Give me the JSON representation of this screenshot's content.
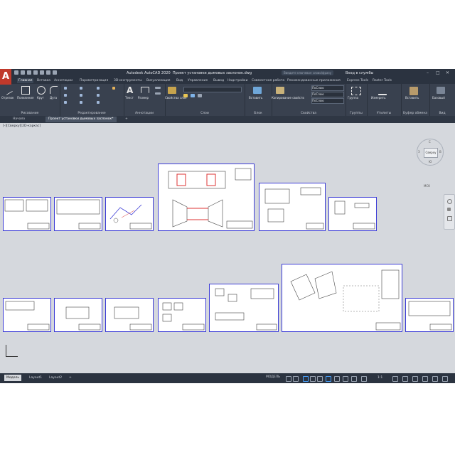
{
  "app": {
    "title": "Autodesk AutoCAD 2020",
    "document": "Проект установки дымовых заслонок.dwg",
    "search_placeholder": "Введите ключевое слово/фразу",
    "user": "Вход в службы",
    "logo": "A"
  },
  "ribbon_tabs": [
    "Главная",
    "Вставка",
    "Аннотации",
    "Параметризация",
    "3D-инструменты",
    "Визуализация",
    "Вид",
    "Управление",
    "Вывод",
    "Надстройки",
    "Совместная работа",
    "Рекомендованные приложения",
    "Express Tools",
    "Raster Tools"
  ],
  "ribbon": {
    "draw": {
      "label": "Рисование",
      "tools": [
        "Отрезок",
        "Полилиния",
        "Круг",
        "Дуга"
      ]
    },
    "modify": {
      "label": "Редактирование"
    },
    "annotation": {
      "label": "Аннотации",
      "tools": [
        "Текст",
        "Размер"
      ]
    },
    "layers": {
      "label": "Слои",
      "tools": [
        "Свойства слоя"
      ]
    },
    "block": {
      "label": "Блок",
      "tools": [
        "Вставить"
      ]
    },
    "properties": {
      "label": "Свойства",
      "tools": [
        "Копирование свойств"
      ],
      "values": [
        "ПоСлою",
        "ПоСлою",
        "ПоСлою"
      ]
    },
    "groups": {
      "label": "Группы",
      "tools": [
        "Группа"
      ]
    },
    "utilities": {
      "label": "Утилиты",
      "tools": [
        "Измерить"
      ]
    },
    "clipboard": {
      "label": "Буфер обмена",
      "tools": [
        "Вставить"
      ]
    },
    "view": {
      "label": "Вид",
      "tools": [
        "Базовый"
      ]
    }
  },
  "doc_tabs": [
    "Начало",
    "Проект установки дымовых заслонок*"
  ],
  "viewport": {
    "label": "[-][Сверху][2D-каркас]",
    "viewcube_face": "Сверху",
    "viewcube_north": "С",
    "viewcube_south": "Ю",
    "viewcube_east": "В",
    "viewcube_west": "З",
    "wcs": "МСК"
  },
  "layout_tabs": [
    "Модель",
    "Layout1",
    "Layout2"
  ],
  "status": {
    "model": "МОДЕЛЬ",
    "scale": "1:1"
  },
  "colors": {
    "accent": "#c0392b",
    "sheet_border": "#3c3cd6",
    "dark_ui": "#2b3340"
  }
}
